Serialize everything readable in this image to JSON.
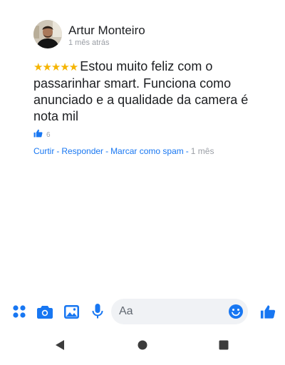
{
  "comment": {
    "author": "Artur Monteiro",
    "time_ago": "1 mês atrás",
    "rating_stars": 5,
    "stars_text": "★★★★★",
    "text": "Estou muito feliz com o passarinhar smart. Funciona como anunciado e a qualidade da camera é nota mil",
    "like_count": "6",
    "actions": {
      "like": "Curtir",
      "reply": "Responder",
      "report_spam": "Marcar como spam",
      "separator": "-",
      "age": "1 mês"
    }
  },
  "composer": {
    "placeholder": "Aa",
    "icons": [
      "apps-grid-icon",
      "camera-icon",
      "gallery-icon",
      "microphone-icon",
      "emoji-icon",
      "thumbs-up-icon"
    ]
  },
  "navigation": {
    "icons": [
      "back-icon",
      "home-icon",
      "recents-icon"
    ]
  },
  "colors": {
    "accent": "#1877f2",
    "star": "#f5b400",
    "muted_text": "#9a9ea5",
    "input_bg": "#f0f2f5"
  }
}
